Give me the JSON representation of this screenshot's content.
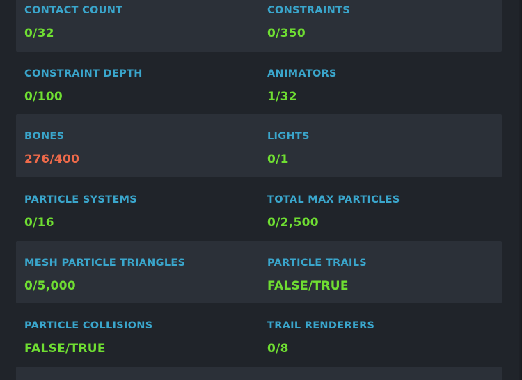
{
  "stats": [
    [
      {
        "label": "CONTACT COUNT",
        "value": "0/32",
        "status": "ok"
      },
      {
        "label": "CONSTRAINTS",
        "value": "0/350",
        "status": "ok"
      }
    ],
    [
      {
        "label": "CONSTRAINT DEPTH",
        "value": "0/100",
        "status": "ok"
      },
      {
        "label": "ANIMATORS",
        "value": "1/32",
        "status": "ok"
      }
    ],
    [
      {
        "label": "BONES",
        "value": "276/400",
        "status": "warn"
      },
      {
        "label": "LIGHTS",
        "value": "0/1",
        "status": "ok"
      }
    ],
    [
      {
        "label": "PARTICLE SYSTEMS",
        "value": "0/16",
        "status": "ok"
      },
      {
        "label": "TOTAL MAX PARTICLES",
        "value": "0/2,500",
        "status": "ok"
      }
    ],
    [
      {
        "label": "MESH PARTICLE TRIANGLES",
        "value": "0/5,000",
        "status": "ok"
      },
      {
        "label": "PARTICLE TRAILS",
        "value": "FALSE/TRUE",
        "status": "ok"
      }
    ],
    [
      {
        "label": "PARTICLE COLLISIONS",
        "value": "FALSE/TRUE",
        "status": "ok"
      },
      {
        "label": "TRAIL RENDERERS",
        "value": "0/8",
        "status": "ok"
      }
    ]
  ],
  "colors": {
    "background": "#20242a",
    "stripe": "#2b3038",
    "label": "#3aa6cc",
    "value_ok": "#6fde32",
    "value_warn": "#ee6a4a"
  }
}
